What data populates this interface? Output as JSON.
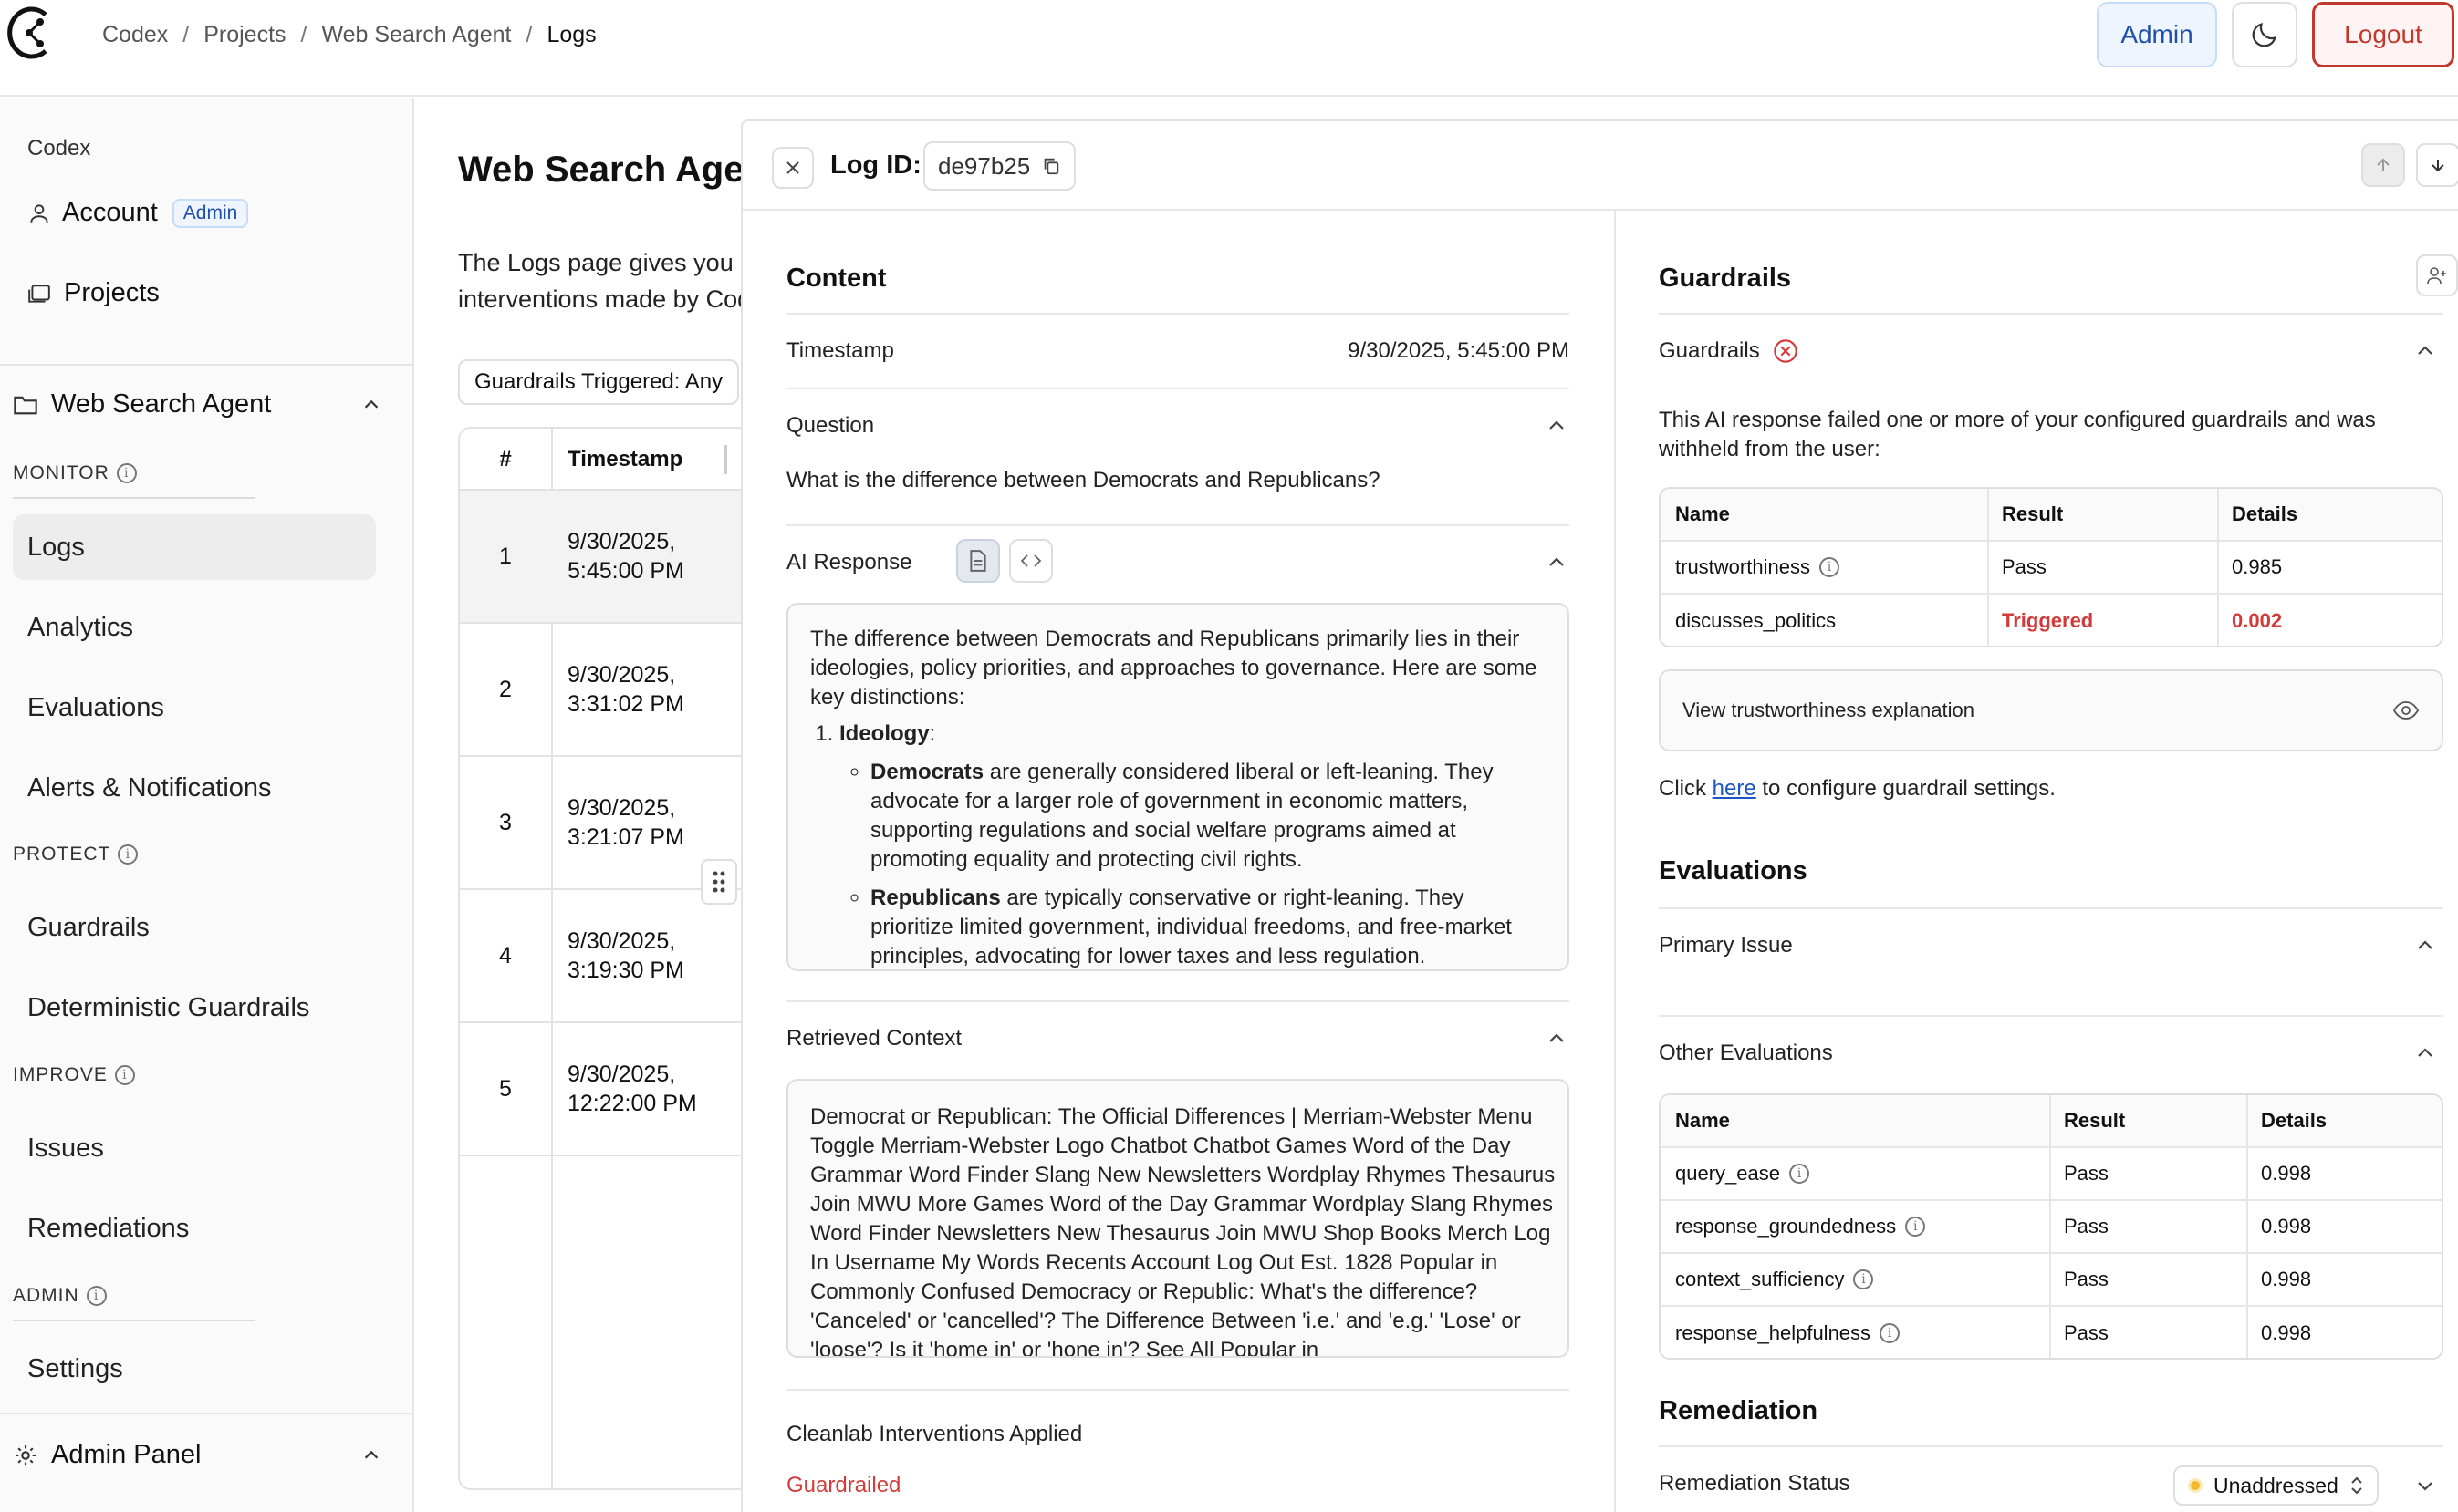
{
  "breadcrumb": [
    "Codex",
    "Projects",
    "Web Search Agent",
    "Logs"
  ],
  "header": {
    "admin_label": "Admin",
    "logout_label": "Logout"
  },
  "sidebar": {
    "org": "Codex",
    "account": "Account",
    "account_badge": "Admin",
    "projects": "Projects",
    "project_name": "Web Search Agent",
    "sections": {
      "monitor": "MONITOR",
      "protect": "PROTECT",
      "improve": "IMPROVE",
      "admin": "ADMIN"
    },
    "items": {
      "logs": "Logs",
      "analytics": "Analytics",
      "evaluations": "Evaluations",
      "alerts": "Alerts & Notifications",
      "guardrails": "Guardrails",
      "deterministic": "Deterministic Guardrails",
      "issues": "Issues",
      "remediations": "Remediations",
      "settings": "Settings"
    },
    "admin_panel": "Admin Panel"
  },
  "main": {
    "title": "Web Search Agent",
    "desc_line1": "The Logs page gives you",
    "desc_line2": "interventions made by Codex",
    "filter": "Guardrails Triggered: Any",
    "table": {
      "headers": [
        "#",
        "Timestamp"
      ],
      "rows": [
        {
          "n": "1",
          "d": "9/30/2025,",
          "t": "5:45:00 PM"
        },
        {
          "n": "2",
          "d": "9/30/2025,",
          "t": "3:31:02 PM"
        },
        {
          "n": "3",
          "d": "9/30/2025,",
          "t": "3:21:07 PM"
        },
        {
          "n": "4",
          "d": "9/30/2025,",
          "t": "3:19:30 PM"
        },
        {
          "n": "5",
          "d": "9/30/2025,",
          "t": "12:22:00 PM"
        }
      ]
    }
  },
  "panel": {
    "log_id_label": "Log ID:",
    "log_id": "de97b25",
    "content": {
      "title": "Content",
      "timestamp_label": "Timestamp",
      "timestamp_value": "9/30/2025, 5:45:00 PM",
      "question_label": "Question",
      "question": "What is the difference between Democrats and Republicans?",
      "ai_response_label": "AI Response",
      "response_intro": "The difference between Democrats and Republicans primarily lies in their ideologies, policy priorities, and approaches to governance. Here are some key distinctions:",
      "response_item1_title": "Ideology",
      "response_dem_bold": "Democrats",
      "response_dem_text": " are generally considered liberal or left-leaning. They advocate for a larger role of government in economic matters, supporting regulations and social welfare programs aimed at promoting equality and protecting civil rights.",
      "response_rep_bold": "Republicans",
      "response_rep_text": " are typically conservative or right-leaning. They prioritize limited government, individual freedoms, and free-market principles, advocating for lower taxes and less regulation.",
      "retrieved_label": "Retrieved Context",
      "retrieved_text": "Democrat or Republican: The Official Differences | Merriam-Webster Menu Toggle Merriam-Webster Logo Chatbot Chatbot Games Word of the Day Grammar Word Finder Slang New Newsletters Wordplay Rhymes Thesaurus Join MWU More Games Word of the Day Grammar Wordplay Slang Rhymes Word Finder Newsletters New Thesaurus Join MWU Shop Books Merch Log In Username My Words Recents Account Log Out Est. 1828 Popular in Commonly Confused Democracy or Republic: What's the difference? 'Canceled' or 'cancelled'? The Difference Between 'i.e.' and 'e.g.' 'Lose' or 'loose'? Is it 'home in' or 'hone in'? See All Popular in",
      "interventions_label": "Cleanlab Interventions Applied",
      "interventions_value": "Guardrailed"
    },
    "guardrails": {
      "title": "Guardrails",
      "subtitle": "Guardrails",
      "message": "This AI response failed one or more of your configured guardrails and was withheld from the user:",
      "headers": [
        "Name",
        "Result",
        "Details"
      ],
      "rows": [
        {
          "name": "trustworthiness",
          "result": "Pass",
          "details": "0.985"
        },
        {
          "name": "discusses_politics",
          "result": "Triggered",
          "details": "0.002"
        }
      ],
      "view_explanation": "View trustworthiness explanation",
      "config_prefix": "Click ",
      "config_link": "here",
      "config_suffix": " to configure guardrail settings."
    },
    "evaluations": {
      "title": "Evaluations",
      "primary_issue": "Primary Issue",
      "other": "Other Evaluations",
      "headers": [
        "Name",
        "Result",
        "Details"
      ],
      "rows": [
        {
          "name": "query_ease",
          "result": "Pass",
          "details": "0.998"
        },
        {
          "name": "response_groundedness",
          "result": "Pass",
          "details": "0.998"
        },
        {
          "name": "context_sufficiency",
          "result": "Pass",
          "details": "0.998"
        },
        {
          "name": "response_helpfulness",
          "result": "Pass",
          "details": "0.998"
        }
      ]
    },
    "remediation": {
      "title": "Remediation",
      "status_label": "Remediation Status",
      "status_value": "Unaddressed"
    }
  },
  "colors": {
    "accent_blue": "#1f4fa8",
    "danger": "#d33b3b",
    "status_dot": "#f5b82e"
  }
}
